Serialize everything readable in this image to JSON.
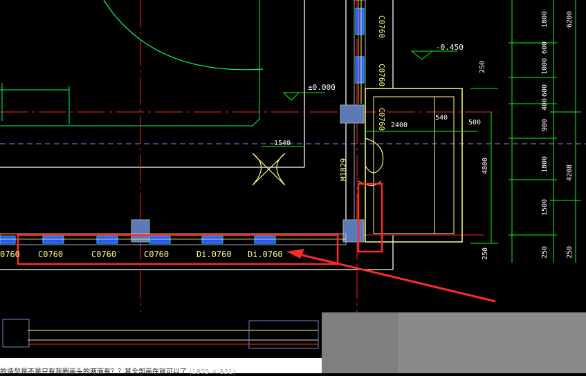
{
  "drawing": {
    "window_labels": [
      "C0760",
      "C0760",
      "C0760",
      "Di.0760",
      "Di.0760"
    ],
    "window_label_partial": "0760",
    "vertical_window_labels": [
      "C0760",
      "C0760",
      "C0760"
    ],
    "door_label": "M1829",
    "elevations": {
      "top_right": "-0.450",
      "center": "±0.000"
    },
    "dims_inner": {
      "d1540": "1540",
      "d2400": "2400",
      "d540": "540",
      "d500": "500",
      "d250_top": "250"
    },
    "right_dims_col1": [
      "1800",
      "600",
      "1000",
      "600",
      "400",
      "900",
      "1800",
      "1500",
      "250"
    ],
    "right_dims_col2": [
      "6200",
      "4208",
      "250"
    ],
    "left_dims_col": [
      "4800"
    ],
    "colors": {
      "wall": "#ffff80",
      "dim": "#00ff00",
      "axis": "#ff2020",
      "column": "#5a7ab8",
      "window": "#3050ff",
      "hatch": "#00e0ff",
      "annotation": "#ff2a2a",
      "dashed": "#b070ff",
      "wall_white": "#d8d8d8"
    }
  },
  "caption": {
    "text": "的造型是不是只有我圈画头的两面有？？其全部画在就可以了",
    "dim_text": "(1875 × 821)"
  }
}
